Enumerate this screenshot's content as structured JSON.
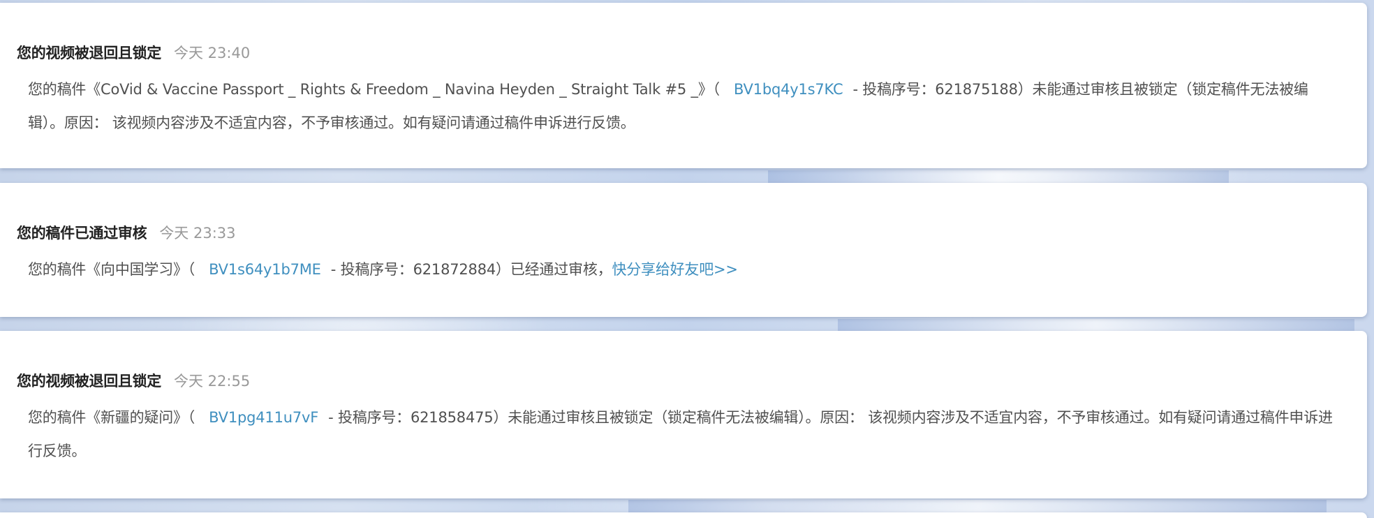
{
  "messages": [
    {
      "title": "您的视频被退回且锁定",
      "time": "今天 23:40",
      "body_pre": "您的稿件《CoVid & Vaccine Passport _ Rights & Freedom _ Navina Heyden _ Straight Talk #5 _》（",
      "bvid": "BV1bq4y1s7KC",
      "body_post": "- 投稿序号：621875188）未能通过审核且被锁定（锁定稿件无法被编辑）。原因： 该视频内容涉及不适宜内容，不予审核通过。如有疑问请通过稿件申诉进行反馈。"
    },
    {
      "title": "您的稿件已通过审核",
      "time": "今天 23:33",
      "body_pre": "您的稿件《向中国学习》（",
      "bvid": "BV1s64y1b7ME",
      "body_post": "- 投稿序号：621872884）已经通过审核，",
      "share_link": "快分享给好友吧>>"
    },
    {
      "title": "您的视频被退回且锁定",
      "time": "今天 22:55",
      "body_pre": "您的稿件《新疆的疑问》（",
      "bvid": "BV1pg411u7vF",
      "body_post": "- 投稿序号：621858475）未能通过审核且被锁定（锁定稿件无法被编辑）。原因： 该视频内容涉及不适宜内容，不予审核通过。如有疑问请通过稿件申诉进行反馈。"
    }
  ],
  "colors": {
    "title": "#222222",
    "time": "#999999",
    "body": "#505050",
    "link": "#3f8fbf"
  }
}
